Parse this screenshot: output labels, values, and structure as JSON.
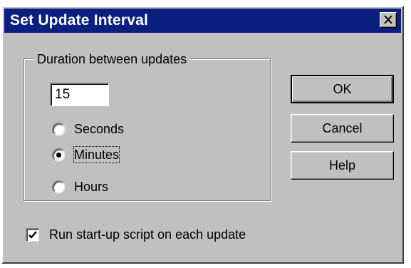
{
  "window": {
    "title": "Set Update Interval",
    "close_icon": "close-icon",
    "titlebar_color": "#0a1f80"
  },
  "duration_group": {
    "legend": "Duration between updates",
    "value": "15",
    "units": [
      {
        "label": "Seconds",
        "selected": false
      },
      {
        "label": "Minutes",
        "selected": true
      },
      {
        "label": "Hours",
        "selected": false
      }
    ]
  },
  "buttons": {
    "ok": "OK",
    "cancel": "Cancel",
    "help": "Help"
  },
  "options": {
    "startup_script_label": "Run start-up script on each update",
    "startup_script_checked": true
  }
}
